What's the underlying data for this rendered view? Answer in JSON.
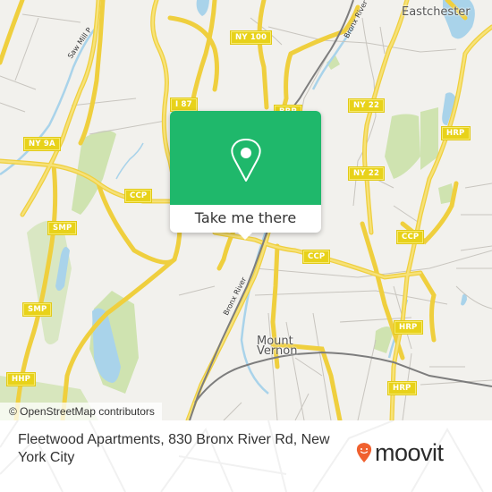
{
  "map": {
    "place_labels": {
      "eastchester": "Eastchester",
      "mount_vernon_line1": "Mount",
      "mount_vernon_line2": "Vernon"
    },
    "road_labels": {
      "saw_mill": "Saw Mill P",
      "bronx_river_north": "Bronx River",
      "bronx_river_south": "Bronx River"
    },
    "shields": {
      "ny9a": "NY 9A",
      "ny100": "NY 100",
      "i87": "I 87",
      "brp": "BRP",
      "ny22_north": "NY 22",
      "ny22_south": "NY 22",
      "hrp_north": "HRP",
      "hrp_mid": "HRP",
      "hrp_south": "HRP",
      "ccp_west": "CCP",
      "ccp_center": "CCP",
      "ccp_east": "CCP",
      "smp_north": "SMP",
      "smp_south": "SMP",
      "hhp": "HHP"
    },
    "attribution": "© OpenStreetMap contributors",
    "colors": {
      "background": "#f2f1ed",
      "road": "#f5dc5a",
      "water": "#a9d3ea",
      "park": "#cfe3b0",
      "rail": "#7d7d7d",
      "minor_road": "#c8c5bf"
    }
  },
  "popup": {
    "icon": "location-pin-icon",
    "cta_label": "Take me there",
    "color": "#1fb86b"
  },
  "footer": {
    "address": "Fleetwood Apartments, 830 Bronx River Rd, New York City",
    "logo_text": "moovit",
    "logo_icon": "moovit-pin-icon",
    "logo_color": "#f0612f"
  }
}
